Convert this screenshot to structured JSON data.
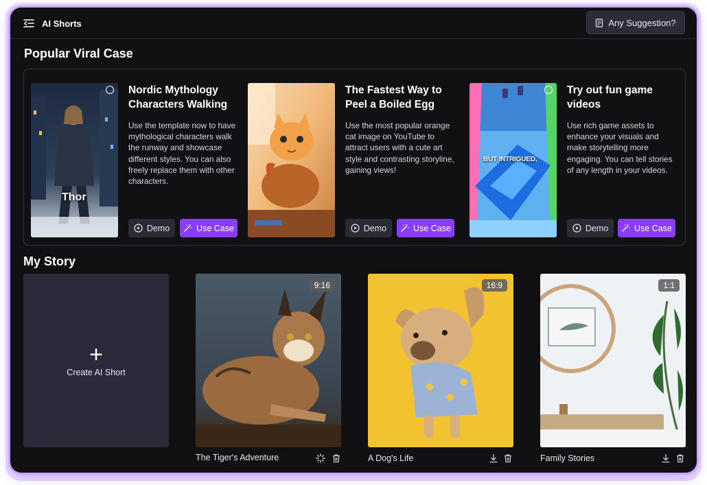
{
  "app": {
    "title": "AI Shorts",
    "suggestion_label": "Any Suggestion?"
  },
  "popular": {
    "heading": "Popular Viral Case",
    "cases": [
      {
        "title": "Nordic Mythology Characters Walking",
        "description": "Use the template now to have mythological characters walk the runway and showcase different styles. You can also freely replace them with other characters.",
        "thumb_label": "Thor",
        "demo_label": "Demo",
        "use_label": "Use Case"
      },
      {
        "title": "The Fastest Way to Peel a Boiled Egg",
        "description": "Use the most popular orange cat image on YouTube to attract users with a cute art style and contrasting storyline, gaining views!",
        "demo_label": "Demo",
        "use_label": "Use Case"
      },
      {
        "title": "Try out fun game videos",
        "description": "Use rich game assets to enhance your visuals and make storytelling more engaging. You can tell stories of any length in your videos.",
        "thumb_caption": "BUT INTRIGUED,",
        "demo_label": "Demo",
        "use_label": "Use Case"
      }
    ]
  },
  "story": {
    "heading": "My Story",
    "create_label": "Create AI Short",
    "items": [
      {
        "name": "The Tiger's Adventure",
        "ratio": "9:16"
      },
      {
        "name": "A Dog's Life",
        "ratio": "16:9"
      },
      {
        "name": "Family Stories",
        "ratio": "1:1"
      }
    ]
  },
  "colors": {
    "accent": "#8b3dff",
    "background": "#111114",
    "card": "#2a2a3a"
  }
}
